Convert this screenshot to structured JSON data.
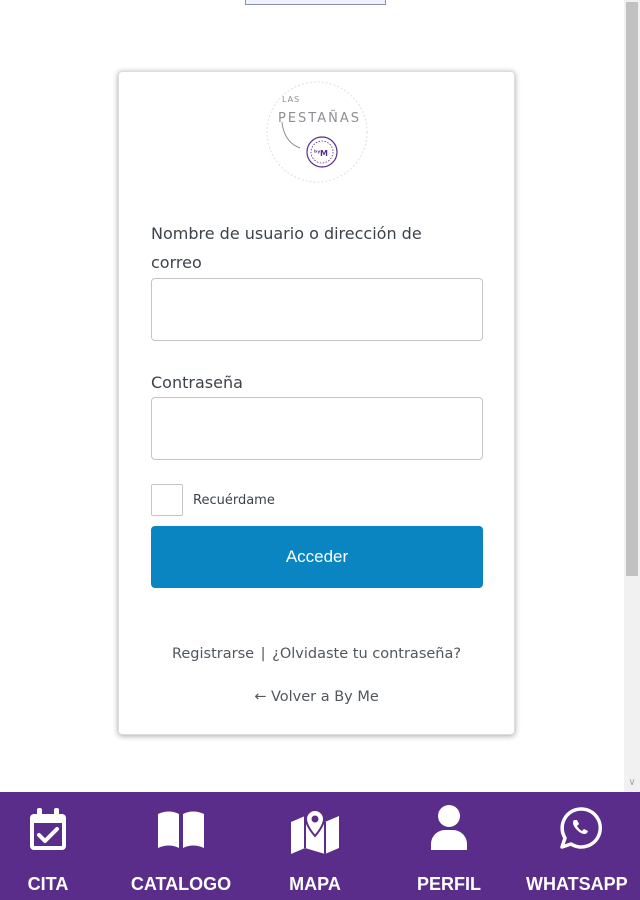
{
  "login": {
    "username_label": "Nombre de usuario o dirección de correo",
    "username_value": "",
    "password_label": "Contraseña",
    "password_value": "",
    "remember_label": "Recuérdame",
    "submit_label": "Acceder",
    "register_link": "Registrarse",
    "separator": "|",
    "forgot_link": "¿Olvidaste tu contraseña?",
    "back_link": "← Volver a By Me"
  },
  "logo": {
    "text": "PESTAÑAS",
    "accent": "#5a2d8a"
  },
  "bottom_nav": {
    "background": "#5a2d8a",
    "items": [
      {
        "label": "CITA",
        "icon": "calendar-check-icon"
      },
      {
        "label": "CATALOGO",
        "icon": "book-open-icon"
      },
      {
        "label": "MAPA",
        "icon": "map-pin-icon"
      },
      {
        "label": "PERFIL",
        "icon": "user-icon"
      },
      {
        "label": "WHATSAPP",
        "icon": "whatsapp-icon"
      }
    ]
  },
  "colors": {
    "button": "#0a85c2",
    "nav": "#5a2d8a"
  }
}
